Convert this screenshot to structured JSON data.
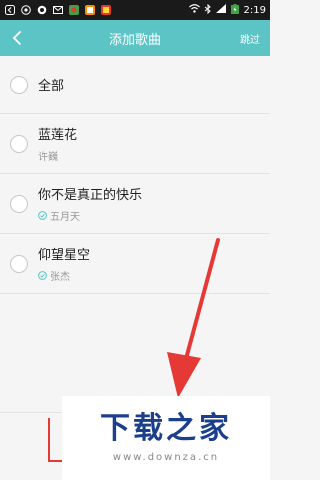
{
  "status_bar": {
    "time": "2:19",
    "left_icons": [
      "back-icon",
      "app-icon",
      "app-icon",
      "mail-icon",
      "app-icon",
      "app-icon",
      "app-icon"
    ],
    "right_icons": [
      "wifi-icon",
      "bluetooth-icon",
      "signal-icon",
      "battery-icon"
    ]
  },
  "app_bar": {
    "title": "添加歌曲",
    "skip_label": "跳过",
    "background": "#5cc4c4"
  },
  "list": {
    "items": [
      {
        "title": "全部"
      },
      {
        "title": "蓝莲花",
        "artist": "许巍",
        "checked": false
      },
      {
        "title": "你不是真正的快乐",
        "artist": "五月天",
        "checked": true
      },
      {
        "title": "仰望星空",
        "artist": "张杰",
        "checked": true
      }
    ]
  },
  "watermark": {
    "brand": "下载之家",
    "url": "www.downza.cn"
  },
  "colors": {
    "accent": "#5cc4c4",
    "annotation": "#e53935",
    "watermark_brand": "#1b3f8b"
  }
}
